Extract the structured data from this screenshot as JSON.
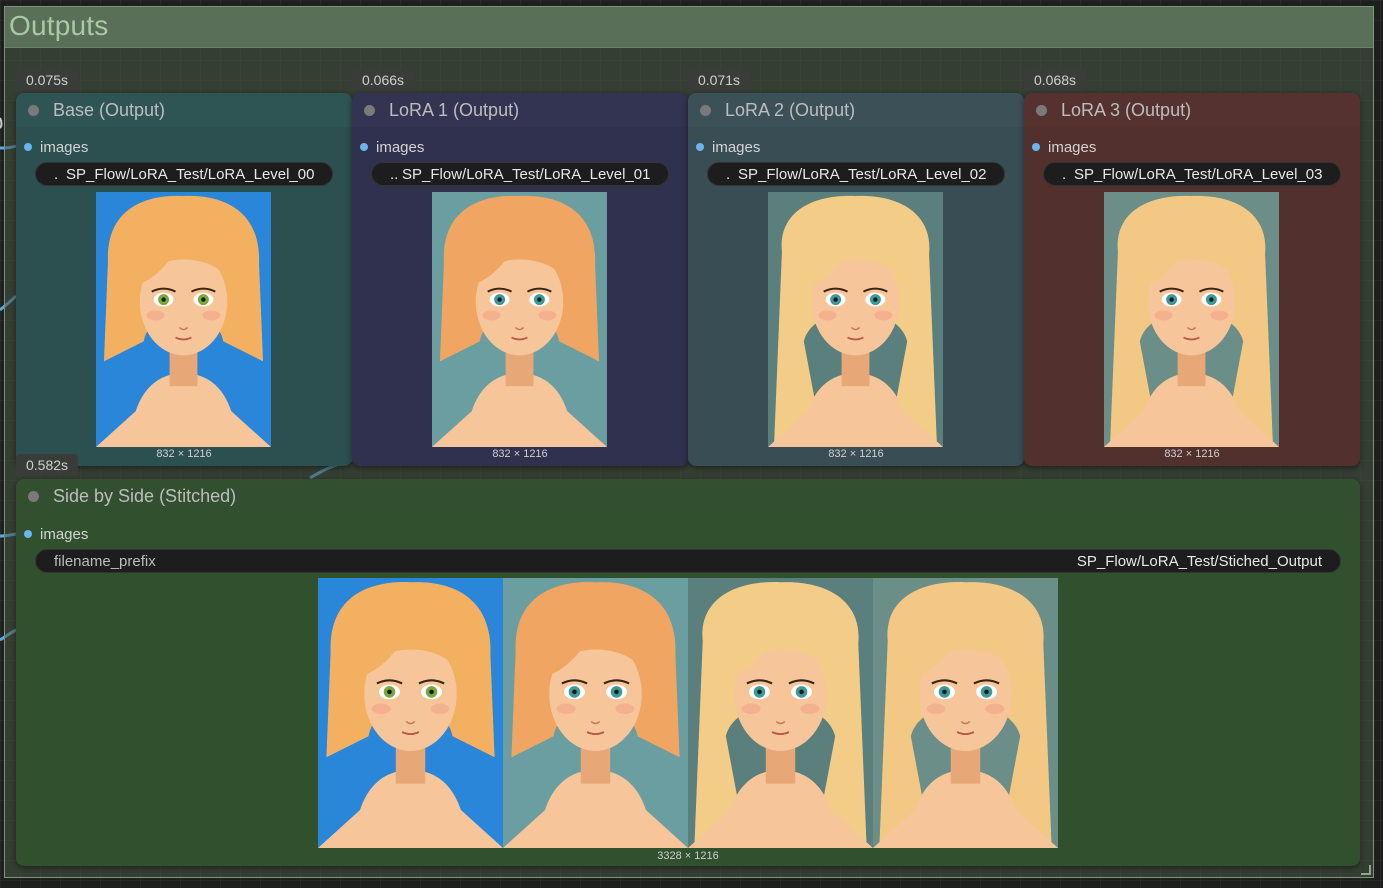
{
  "group": {
    "title": "Outputs"
  },
  "nodes": [
    {
      "time": "0.075s",
      "title": "Base (Output)",
      "slot": "images",
      "prefix_mark": ".",
      "filename": "SP_Flow/LoRA_Test/LoRA_Level_00",
      "dims": "832 × 1216",
      "header_color": "#2e5454",
      "body_color": "#2c4f4f"
    },
    {
      "time": "0.066s",
      "title": "LoRA 1 (Output)",
      "slot": "images",
      "prefix_mark": "..",
      "filename": "SP_Flow/LoRA_Test/LoRA_Level_01",
      "dims": "832 × 1216",
      "header_color": "#333352",
      "body_color": "#30304f"
    },
    {
      "time": "0.071s",
      "title": "LoRA 2 (Output)",
      "slot": "images",
      "prefix_mark": ".",
      "filename": "SP_Flow/LoRA_Test/LoRA_Level_02",
      "dims": "832 × 1216",
      "header_color": "#3c5058",
      "body_color": "#394d55"
    },
    {
      "time": "0.068s",
      "title": "LoRA 3 (Output)",
      "slot": "images",
      "prefix_mark": ".",
      "filename": "SP_Flow/LoRA_Test/LoRA_Level_03",
      "dims": "832 × 1216",
      "header_color": "#553230",
      "body_color": "#51302e"
    }
  ],
  "stitched": {
    "time": "0.582s",
    "title": "Side by Side (Stitched)",
    "slot": "images",
    "widget_label": "filename_prefix",
    "widget_value": "SP_Flow/LoRA_Test/Stiched_Output",
    "dims": "3328 × 1216",
    "header_color": "#32502f",
    "body_color": "#30502e"
  },
  "portraits": [
    {
      "name": "portrait-blue-bg",
      "bg": "#2a86d8",
      "hair": "#f2b060",
      "eye": "#7aa83a"
    },
    {
      "name": "portrait-teal-bg",
      "bg": "#6a9ea0",
      "hair": "#f0a662",
      "eye": "#3d9a98"
    },
    {
      "name": "portrait-long-hair",
      "bg": "#5a7f7c",
      "hair": "#f3cc88",
      "eye": "#3d9a98"
    },
    {
      "name": "portrait-long-hair-2",
      "bg": "#6b8e88",
      "hair": "#f2c884",
      "eye": "#3d9a98"
    }
  ]
}
